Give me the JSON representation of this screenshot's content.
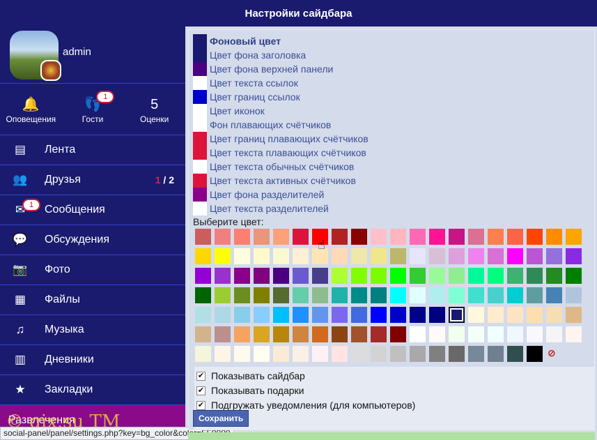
{
  "header": {
    "title": "Настройки сайдбара"
  },
  "profile": {
    "username": "admin"
  },
  "quick_links": [
    {
      "label": "Оповещения",
      "icon": "bell-icon",
      "glyph": "🔔",
      "badge": null
    },
    {
      "label": "Гости",
      "icon": "footprints-icon",
      "glyph": "👣",
      "badge": "1"
    },
    {
      "label": "Оценки",
      "icon": "rating-icon",
      "glyph": "5",
      "badge": null
    }
  ],
  "nav": [
    {
      "label": "Лента",
      "icon": "feed-icon",
      "glyph": "▤"
    },
    {
      "label": "Друзья",
      "icon": "friends-icon",
      "glyph": "👥",
      "count_active": "1",
      "count_total": " / 2"
    },
    {
      "label": "Сообщения",
      "icon": "mail-icon",
      "glyph": "✉",
      "badge": "1"
    },
    {
      "label": "Обсуждения",
      "icon": "discussions-icon",
      "glyph": "💬"
    },
    {
      "label": "Фото",
      "icon": "camera-icon",
      "glyph": "📷"
    },
    {
      "label": "Файлы",
      "icon": "file-icon",
      "glyph": "▦"
    },
    {
      "label": "Музыка",
      "icon": "music-icon",
      "glyph": "♫"
    },
    {
      "label": "Дневники",
      "icon": "diary-icon",
      "glyph": "▥"
    },
    {
      "label": "Закладки",
      "icon": "star-icon",
      "glyph": "★"
    }
  ],
  "nav_extra": {
    "label": "Развлечения"
  },
  "watermark": "© gix.su TM",
  "status_url": "social-panel/panel/settings.php?key=bg_color&color=FF0000",
  "color_settings": [
    {
      "label": "Фоновый цвет",
      "color": "#191970",
      "active": true
    },
    {
      "label": "Цвет фона заголовка",
      "color": "#191970"
    },
    {
      "label": "Цвет фона верхней панели",
      "color": "#4b0082"
    },
    {
      "label": "Цвет текста ссылок",
      "color": "#ffffff"
    },
    {
      "label": "Цвет границ ссылок",
      "color": "#0000cd"
    },
    {
      "label": "Цвет иконок",
      "color": "#ffffff"
    },
    {
      "label": "Фон плавающих счётчиков",
      "color": "#ffffff"
    },
    {
      "label": "Цвет границ плавающих счётчиков",
      "color": "#dc143c"
    },
    {
      "label": "Цвет текста плавающих счётчиков",
      "color": "#dc143c"
    },
    {
      "label": "Цвет текста обычных счётчиков",
      "color": "#ffffff"
    },
    {
      "label": "Цвет текста активных счётчиков",
      "color": "#dc143c"
    },
    {
      "label": "Цвет фона разделителей",
      "color": "#8b008b"
    },
    {
      "label": "Цвет текста разделителей",
      "color": "#ffffff"
    }
  ],
  "choose_label": "Выберите цвет:",
  "palette": [
    [
      "#cd5c5c",
      "#f08080",
      "#fa8072",
      "#e9967a",
      "#ffa07a",
      "#dc143c",
      "#ff0000",
      "#b22222",
      "#8b0000",
      "#ffc0cb",
      "#ffb6c1",
      "#ff69b4",
      "#ff1493",
      "#c71585",
      "#db7093",
      "#ff7f50",
      "#ff6347",
      "#ff4500",
      "#ff8c00",
      "#ffa500"
    ],
    [
      "#ffd700",
      "#ffff00",
      "#ffffe0",
      "#fffacd",
      "#fafad2",
      "#ffefd5",
      "#ffe4b5",
      "#ffdab9",
      "#eee8aa",
      "#f0e68c",
      "#bdb76b",
      "#e6e6fa",
      "#d8bfd8",
      "#dda0dd",
      "#ee82ee",
      "#da70d6",
      "#ff00ff",
      "#ba55d3",
      "#9370db",
      "#8a2be2"
    ],
    [
      "#9400d3",
      "#9932cc",
      "#8b008b",
      "#800080",
      "#4b0082",
      "#6a5acd",
      "#483d8b",
      "#adff2f",
      "#7fff00",
      "#7cfc00",
      "#00ff00",
      "#32cd32",
      "#98fb98",
      "#90ee90",
      "#00fa9a",
      "#00ff7f",
      "#3cb371",
      "#2e8b57",
      "#228b22",
      "#008000"
    ],
    [
      "#006400",
      "#9acd32",
      "#6b8e23",
      "#808000",
      "#556b2f",
      "#66cdaa",
      "#8fbc8f",
      "#20b2aa",
      "#008b8b",
      "#008080",
      "#00ffff",
      "#e0ffff",
      "#afeeee",
      "#7fffd4",
      "#40e0d0",
      "#48d1cc",
      "#00ced1",
      "#5f9ea0",
      "#4682b4",
      "#b0c4de"
    ],
    [
      "#b0e0e6",
      "#add8e6",
      "#87ceeb",
      "#87cefa",
      "#00bfff",
      "#1e90ff",
      "#6495ed",
      "#7b68ee",
      "#4169e1",
      "#0000ff",
      "#0000cd",
      "#00008b",
      "#000080",
      "#191970",
      "#fff8dc",
      "#ffebcd",
      "#ffe4c4",
      "#ffdead",
      "#f5deb3",
      "#deb887"
    ],
    [
      "#d2b48c",
      "#bc8f8f",
      "#f4a460",
      "#daa520",
      "#b8860b",
      "#cd853f",
      "#d2691e",
      "#8b4513",
      "#a0522d",
      "#a52a2a",
      "#800000",
      "#ffffff",
      "#fffafa",
      "#f0fff0",
      "#f5fffa",
      "#f0ffff",
      "#f0f8ff",
      "#f8f8ff",
      "#f5f5f5",
      "#fff5ee"
    ],
    [
      "#f5f5dc",
      "#fdf5e6",
      "#fffaf0",
      "#fffff0",
      "#faebd7",
      "#faf0e6",
      "#fff0f5",
      "#ffe4e1",
      "#dcdcdc",
      "#d3d3d3",
      "#c0c0c0",
      "#a9a9a9",
      "#808080",
      "#696969",
      "#778899",
      "#708090",
      "#2f4f4f",
      "#000000"
    ]
  ],
  "options": [
    {
      "label": "Показывать сайдбар",
      "checked": true
    },
    {
      "label": "Показывать подарки",
      "checked": true
    },
    {
      "label": "Подгружать уведомления (для компьютеров)",
      "checked": true
    }
  ],
  "save_label": "Сохранить"
}
